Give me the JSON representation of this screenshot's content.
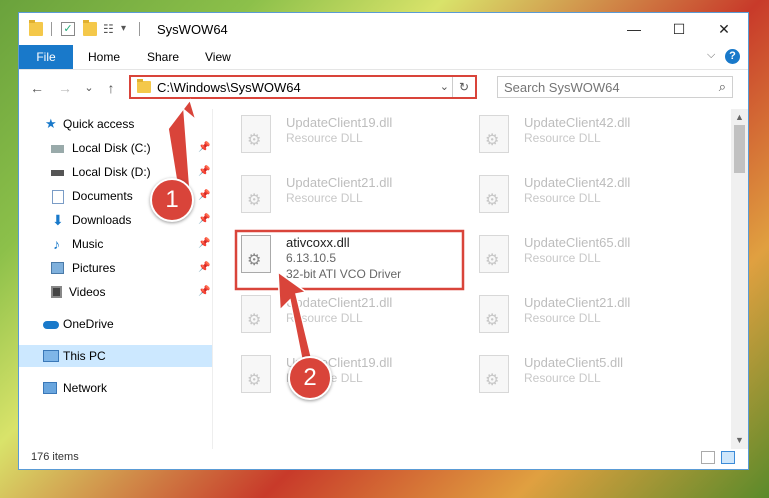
{
  "titlebar": {
    "title": "SysWOW64",
    "minimize": "—",
    "maximize": "☐",
    "close": "✕"
  },
  "ribbon": {
    "tabs": [
      "File",
      "Home",
      "Share",
      "View"
    ],
    "expand": "⌵",
    "help": "?"
  },
  "nav": {
    "back": "←",
    "forward": "→",
    "recent": "⌄",
    "up": "↑"
  },
  "address": {
    "path": "C:\\Windows\\SysWOW64",
    "dropdown": "⌄",
    "refresh": "↻"
  },
  "search": {
    "placeholder": "Search SysWOW64",
    "icon": "⌕"
  },
  "sidebar": {
    "items": [
      {
        "label": "Quick access",
        "icon": "star-icon"
      },
      {
        "label": "Local Disk (C:)",
        "icon": "drive-icon",
        "pin": "📌"
      },
      {
        "label": "Local Disk (D:)",
        "icon": "drive-icon",
        "pin": "📌"
      },
      {
        "label": "Documents",
        "icon": "documents-icon",
        "pin": "📌"
      },
      {
        "label": "Downloads",
        "icon": "downloads-icon",
        "pin": "📌"
      },
      {
        "label": "Music",
        "icon": "music-icon",
        "pin": "📌"
      },
      {
        "label": "Pictures",
        "icon": "pictures-icon",
        "pin": "📌"
      },
      {
        "label": "Videos",
        "icon": "videos-icon",
        "pin": "📌"
      },
      {
        "label": "OneDrive",
        "icon": "cloud-icon"
      },
      {
        "label": "This PC",
        "icon": "pc-icon"
      },
      {
        "label": "Network",
        "icon": "network-icon"
      }
    ]
  },
  "files": [
    {
      "name": "UpdateClient19.dll",
      "desc": "Resource DLL"
    },
    {
      "name": "UpdateClient42.dll",
      "desc": "Resource DLL"
    },
    {
      "name": "UpdateClient21.dll",
      "desc": "Resource DLL"
    },
    {
      "name": "UpdateClient42.dll",
      "desc": "Resource DLL"
    },
    {
      "name": "ativcoxx.dll",
      "desc": "6.13.10.5",
      "desc2": "32-bit ATI VCO Driver"
    },
    {
      "name": "UpdateClient65.dll",
      "desc": "Resource DLL"
    },
    {
      "name": "UpdateClient21.dll",
      "desc": "Resource DLL"
    },
    {
      "name": "UpdateClient21.dll",
      "desc": "Resource DLL"
    },
    {
      "name": "UpdateClient19.dll",
      "desc": "Resource DLL"
    },
    {
      "name": "UpdateClient5.dll",
      "desc": "Resource DLL"
    }
  ],
  "status": {
    "count": "176 items"
  },
  "callouts": [
    "1",
    "2"
  ],
  "colors": {
    "accent": "#1979ca",
    "highlight": "#d9443a",
    "selected": "#cce8ff"
  }
}
